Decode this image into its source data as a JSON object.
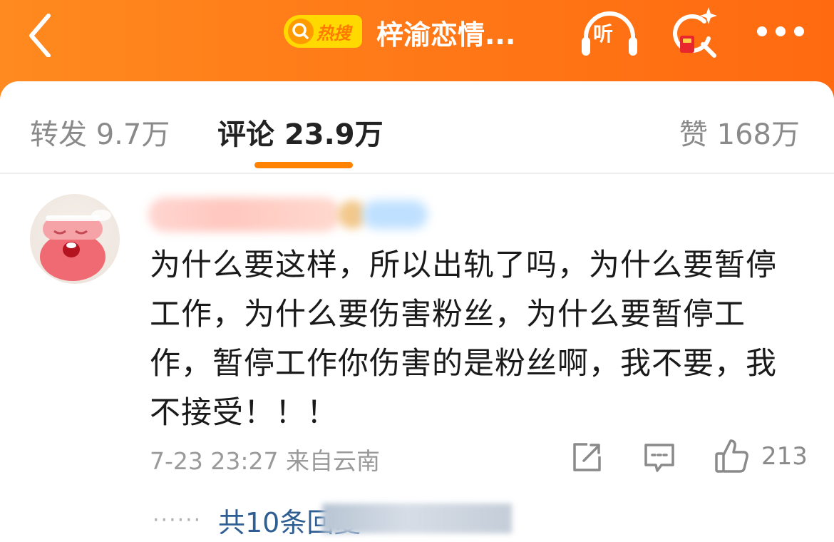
{
  "header": {
    "hot_label": "热搜",
    "title": "梓渝恋情...",
    "listen_label": "听"
  },
  "tabs": [
    {
      "label": "转发",
      "count": "9.7万"
    },
    {
      "label": "评论",
      "count": "23.9万"
    },
    {
      "label": "赞",
      "count": "168万"
    }
  ],
  "comment": {
    "text": "为什么要这样，所以出轨了吗，为什么要暂停工作，为什么要伤害粉丝，为什么要暂停工作，暂停工作你伤害的是粉丝啊，我不要，我不接受！！！",
    "time": "7-23 23:27",
    "location": "来自云南",
    "like_count": "213",
    "replies_text": "共10条回复"
  },
  "icons": {
    "back": "chevron-left-icon",
    "listen": "headphones-icon",
    "search": "search-sparkle-icon",
    "more": "more-dots-icon",
    "repost": "repost-icon",
    "reply": "reply-icon",
    "like": "thumbs-up-icon"
  },
  "colors": {
    "header_gradient_start": "#ff8a1f",
    "header_gradient_end": "#ff6a10",
    "tab_indicator": "#ff8200",
    "link": "#2f5e93"
  }
}
